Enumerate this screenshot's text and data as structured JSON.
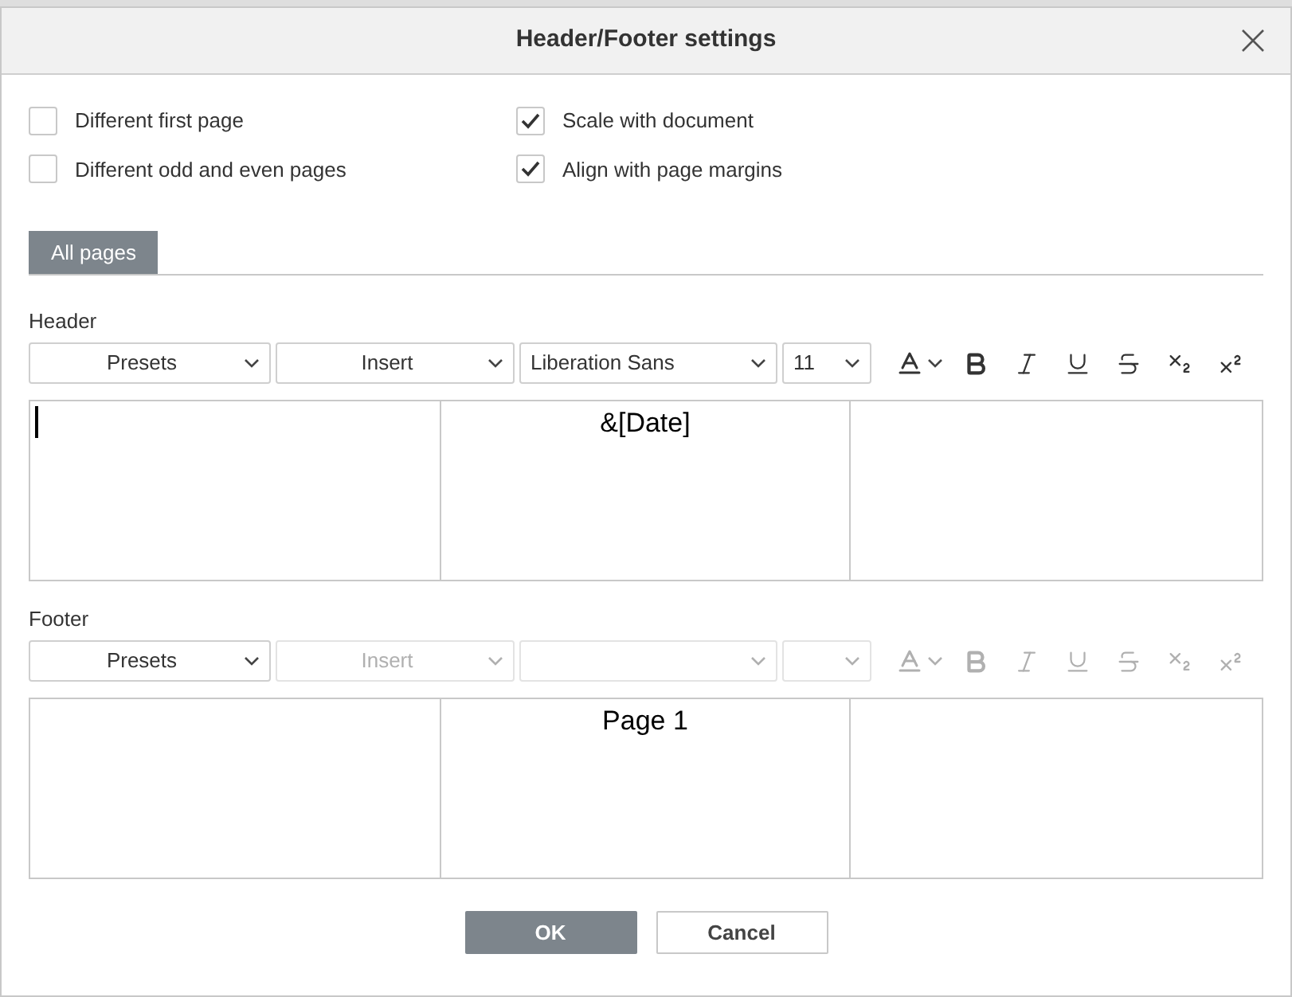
{
  "dialog": {
    "title": "Header/Footer settings"
  },
  "options": [
    {
      "label": "Different first page",
      "checked": false
    },
    {
      "label": "Different odd and even pages",
      "checked": false
    },
    {
      "label": "Scale with document",
      "checked": true
    },
    {
      "label": "Align with page margins",
      "checked": true
    }
  ],
  "tabs": [
    {
      "label": "All pages",
      "selected": true
    }
  ],
  "sections": [
    {
      "label": "Header",
      "presets": "Presets",
      "insert": "Insert",
      "font": "Liberation Sans",
      "size": "11",
      "disabled": false,
      "cursor": true,
      "center": "&[Date]"
    },
    {
      "label": "Footer",
      "presets": "Presets",
      "insert": "Insert",
      "disabled": true,
      "center": "Page 1"
    }
  ],
  "buttons": [
    {
      "label": "OK",
      "kind": "primary"
    },
    {
      "label": "Cancel",
      "kind": "secondary"
    }
  ]
}
